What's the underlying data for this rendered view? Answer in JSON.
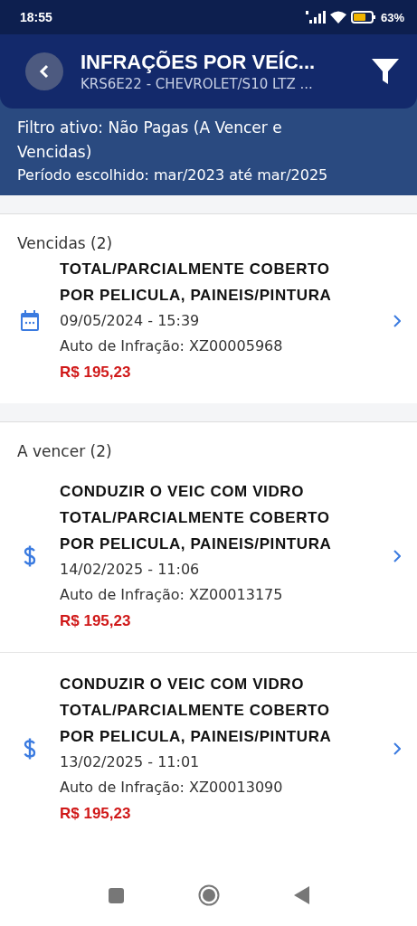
{
  "status_bar": {
    "time": "18:55",
    "battery": "63%"
  },
  "header": {
    "title": "INFRAÇÕES POR VEÍC...",
    "subtitle": "KRS6E22 - CHEVROLET/S10 LTZ ..."
  },
  "filter_info": {
    "active": "Filtro ativo: Não Pagas (A Vencer e Vencidas)",
    "period": "Período escolhido: mar/2023 até mar/2025"
  },
  "sections": [
    {
      "title": "Vencidas (2)",
      "items": [
        {
          "kind": "calendar",
          "title_lines": [
            "TOTAL/PARCIALMENTE COBERTO",
            "POR PELICULA, PAINEIS/PINTURA"
          ],
          "datetime": "09/05/2024 - 15:39",
          "auto": "Auto de Infração: XZ00005968",
          "amount": "R$ 195,23"
        }
      ]
    },
    {
      "title": "A vencer (2)",
      "items": [
        {
          "kind": "dollar",
          "title_lines": [
            "CONDUZIR O VEIC COM VIDRO",
            "TOTAL/PARCIALMENTE COBERTO",
            "POR PELICULA, PAINEIS/PINTURA"
          ],
          "datetime": "14/02/2025 - 11:06",
          "auto": "Auto de Infração: XZ00013175",
          "amount": "R$ 195,23"
        },
        {
          "kind": "dollar",
          "title_lines": [
            "CONDUZIR O VEIC COM VIDRO",
            "TOTAL/PARCIALMENTE COBERTO",
            "POR PELICULA, PAINEIS/PINTURA"
          ],
          "datetime": "13/02/2025 - 11:01",
          "auto": "Auto de Infração: XZ00013090",
          "amount": "R$ 195,23"
        }
      ]
    }
  ]
}
